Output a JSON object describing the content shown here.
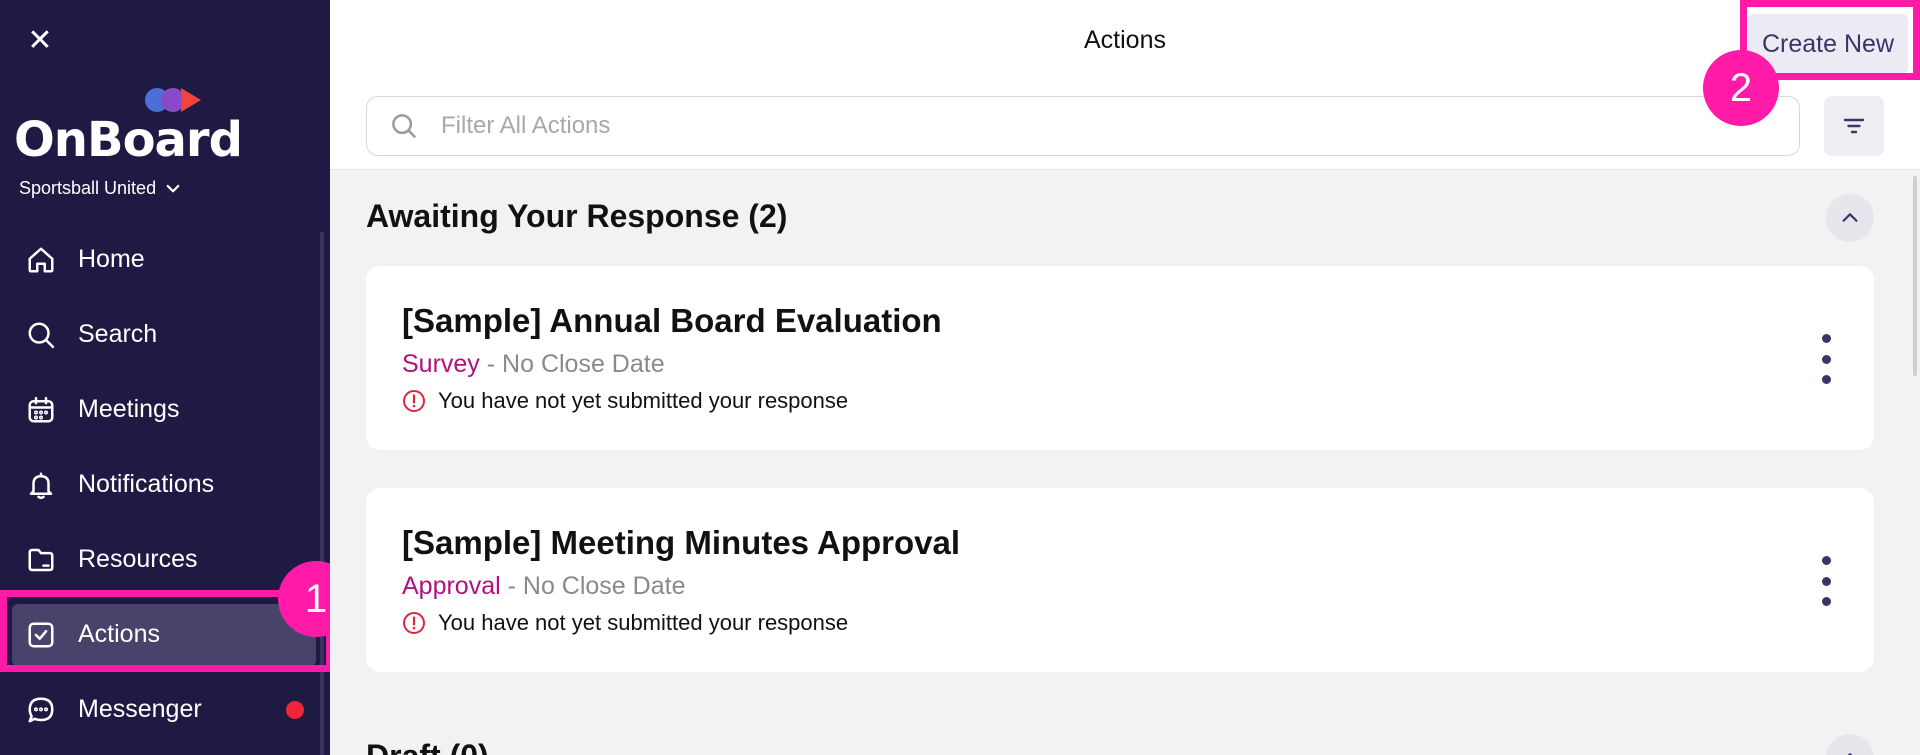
{
  "sidebar": {
    "close_icon": "close-icon",
    "logo_text": "OnBoard",
    "org_name": "Sportsball United",
    "items": [
      {
        "label": "Home",
        "icon": "home-icon"
      },
      {
        "label": "Search",
        "icon": "search-icon"
      },
      {
        "label": "Meetings",
        "icon": "calendar-icon"
      },
      {
        "label": "Notifications",
        "icon": "bell-icon"
      },
      {
        "label": "Resources",
        "icon": "folder-icon"
      },
      {
        "label": "Actions",
        "icon": "check-square-icon",
        "active": true
      },
      {
        "label": "Messenger",
        "icon": "chat-icon",
        "has_unread": true
      }
    ]
  },
  "header": {
    "title": "Actions",
    "create_label": "Create New",
    "search_placeholder": "Filter All Actions"
  },
  "annotations": {
    "step1": "1",
    "step2": "2",
    "highlight_color": "#ff1aa8"
  },
  "sections": [
    {
      "title": "Awaiting Your Response (2)",
      "items": [
        {
          "title": "[Sample] Annual Board Evaluation",
          "type": "Survey",
          "close": "- No Close Date",
          "status": "You have not yet submitted your response"
        },
        {
          "title": "[Sample] Meeting Minutes Approval",
          "type": "Approval",
          "close": "- No Close Date",
          "status": "You have not yet submitted your response"
        }
      ]
    },
    {
      "title": "Draft (0)"
    }
  ],
  "colors": {
    "sidebar_bg": "#1f1a44",
    "accent_type": "#b0117f",
    "unread_dot": "#f0243a",
    "primary_text": "#3b3466"
  }
}
